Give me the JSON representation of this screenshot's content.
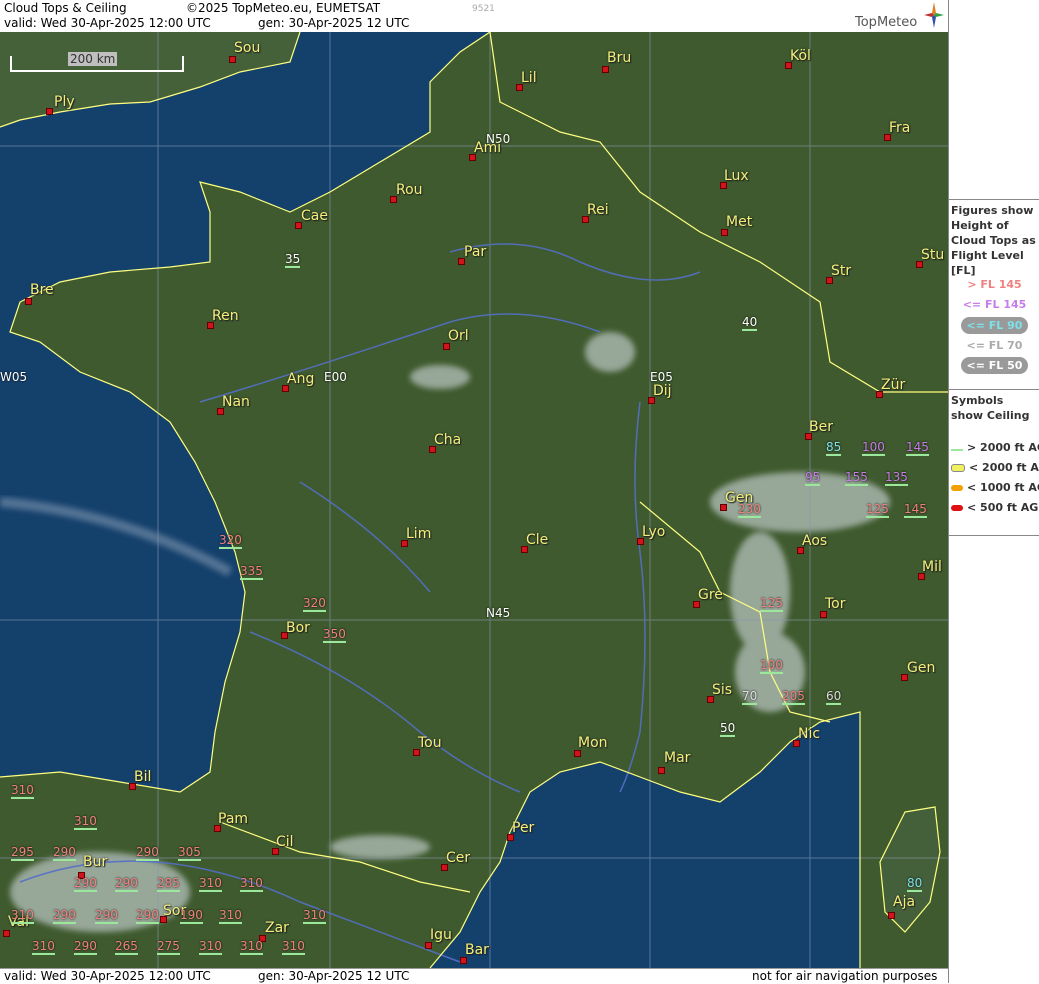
{
  "header": {
    "title": "Cloud Tops & Ceiling",
    "copyright": "©2025 TopMeteo.eu, EUMETSAT",
    "valid": "valid:  Wed  30-Apr-2025  12:00 UTC",
    "gen": "gen: 30-Apr-2025 12 UTC",
    "small_code": "9521",
    "brand": "TopMeteo"
  },
  "footer": {
    "valid": "valid:  Wed  30-Apr-2025  12:00 UTC",
    "gen": "gen: 30-Apr-2025 12 UTC",
    "disclaimer": "not for air navigation purposes"
  },
  "scale_label": "200 km",
  "grid_labels": [
    "N50",
    "N45",
    "E00",
    "E05",
    "W05"
  ],
  "cities": [
    "Sou",
    "Ply",
    "Bru",
    "Köl",
    "Lil",
    "Fra",
    "Ami",
    "Lux",
    "Rou",
    "Cae",
    "Rei",
    "Met",
    "Par",
    "Stu",
    "Str",
    "Bre",
    "Ren",
    "Orl",
    "Ang",
    "Nan",
    "Dij",
    "Zür",
    "Cha",
    "Ber",
    "Gen",
    "Lim",
    "Cle",
    "Lyo",
    "Aos",
    "Mil",
    "Gre",
    "Tor",
    "Bor",
    "Sis",
    "Gen",
    "Nic",
    "Tou",
    "Mon",
    "Mar",
    "Bil",
    "Pam",
    "Cil",
    "Per",
    "Bur",
    "Cer",
    "Sor",
    "Zar",
    "Val",
    "Igu",
    "Bar",
    "Aja"
  ],
  "flight_levels": [
    "35",
    "40",
    "85",
    "100",
    "145",
    "95",
    "155",
    "135",
    "230",
    "145",
    "125",
    "320",
    "335",
    "320",
    "350",
    "125",
    "100",
    "205",
    "70",
    "60",
    "50",
    "310",
    "310",
    "295",
    "290",
    "290",
    "305",
    "290",
    "290",
    "285",
    "310",
    "310",
    "310",
    "290",
    "290",
    "290",
    "190",
    "310",
    "310",
    "310",
    "290",
    "265",
    "275",
    "310",
    "310",
    "310",
    "80"
  ],
  "legend": {
    "figures_title": "Figures show Height of Cloud Tops as Flight Level  [FL]",
    "figures": [
      "> FL 145",
      "<= FL 145",
      "<= FL 90",
      "<= FL 70",
      "<= FL 50"
    ],
    "symbols_title": "Symbols show Ceiling",
    "symbols": [
      "> 2000 ft AGL",
      "< 2000 ft AGL",
      "< 1000 ft AGL",
      "< 500 ft AGL"
    ]
  },
  "colors": {
    "fl_high": "#f08080",
    "fl_145": "#c77ce8",
    "fl_90": "#7ee0e8",
    "fl_70": "#dddddd",
    "fl_50": "#ffffff",
    "city_label": "#f2f07a",
    "sea": "#123a66",
    "land": "#3f5a2e"
  }
}
